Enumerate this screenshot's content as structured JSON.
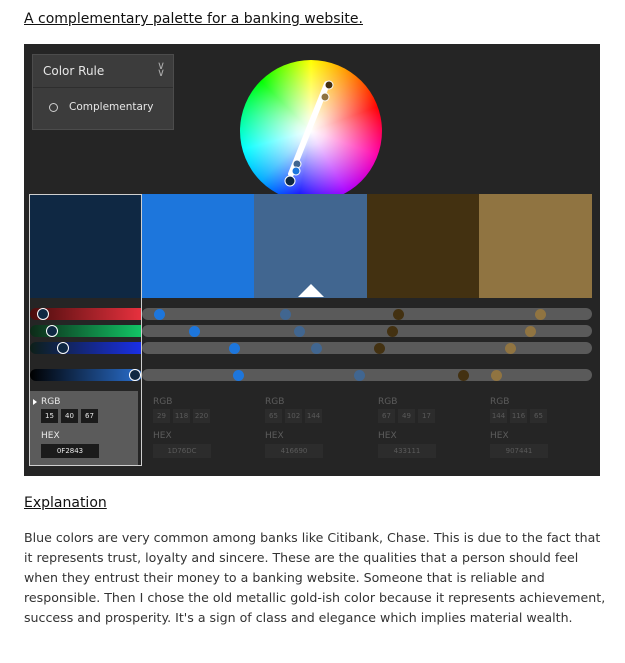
{
  "title": "A complementary palette for a banking website.",
  "tool": {
    "panel_title": "Color Rule",
    "rule_option": "Complementary",
    "swatches": [
      {
        "hex": "0F2843",
        "color": "#0f2843",
        "rgb": [
          "15",
          "40",
          "67"
        ],
        "selected": true
      },
      {
        "hex": "1D76DC",
        "color": "#1d76dc",
        "rgb": [
          "29",
          "118",
          "220"
        ],
        "selected": false
      },
      {
        "hex": "416690",
        "color": "#416690",
        "rgb": [
          "65",
          "102",
          "144"
        ],
        "selected": false
      },
      {
        "hex": "433111",
        "color": "#433111",
        "rgb": [
          "67",
          "49",
          "17"
        ],
        "selected": false
      },
      {
        "hex": "907441",
        "color": "#907441",
        "rgb": [
          "144",
          "116",
          "65"
        ],
        "selected": false
      }
    ],
    "rgb_label": "RGB",
    "hex_label": "HEX"
  },
  "explanation_title": "Explanation",
  "explanation_text": "Blue colors are very common among banks like Citibank, Chase. This is due to the fact that it represents trust, loyalty and sincere. These are the qualities that a person should feel when they entrust their money to a banking website. Someone that is reliable and responsible. Then I chose the old metallic gold-ish color because it represents achievement, success and prosperity. It's a sign of class and elegance which implies material wealth."
}
